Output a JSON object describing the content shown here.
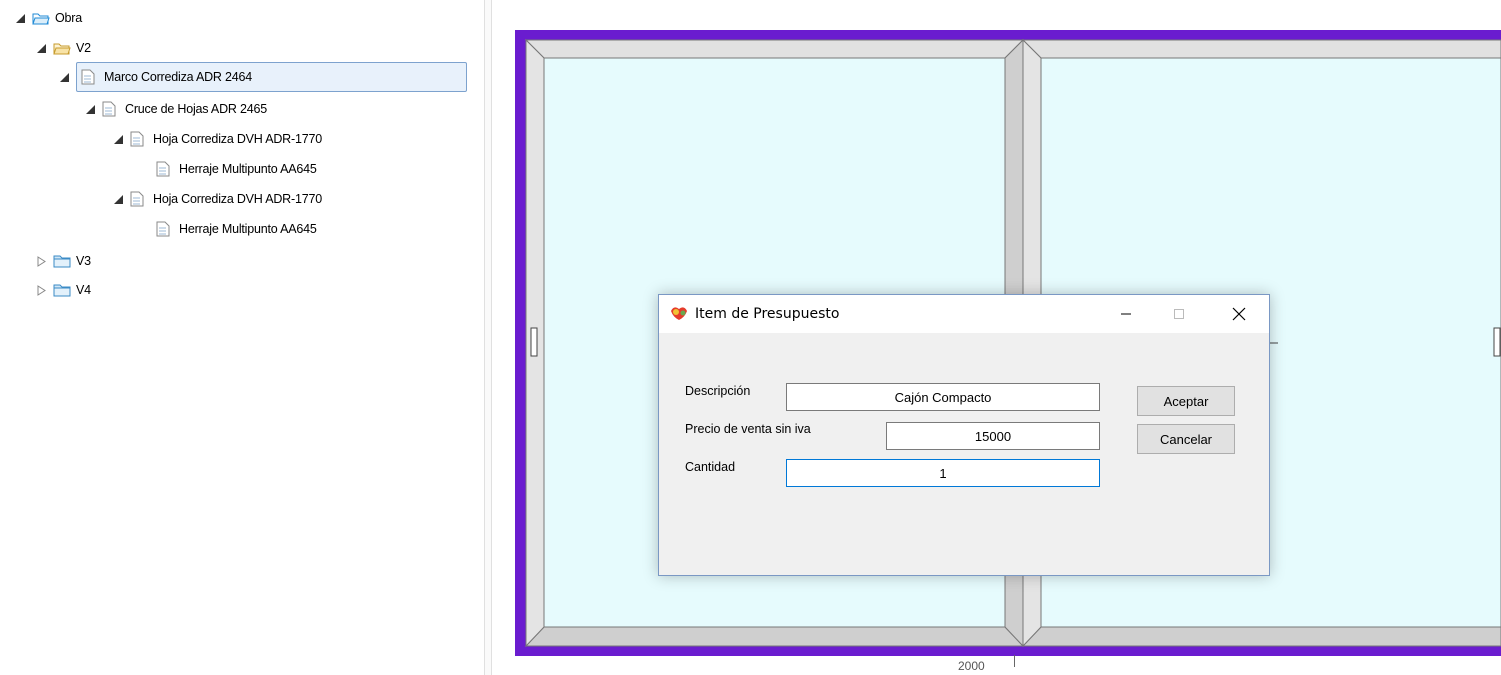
{
  "tree": {
    "obra": "Obra",
    "v2": "V2",
    "marco": "Marco Corrediza ADR 2464",
    "cruce": "Cruce de Hojas ADR 2465",
    "hoja1": "Hoja Corrediza DVH ADR-1770",
    "herraje1": "Herraje Multipunto AA645",
    "hoja2": "Hoja Corrediza DVH ADR-1770",
    "herraje2": "Herraje Multipunto AA645",
    "v3": "V3",
    "v4": "V4"
  },
  "drawing": {
    "dimension": "2000",
    "frame_color": "#6a1ccf",
    "glass_color": "#e6fbfd",
    "profile_color": "#d9d9d9"
  },
  "dialog": {
    "title": "Item de Presupuesto",
    "descripcion_label": "Descripción",
    "descripcion_value": "Cajón Compacto",
    "precio_label": "Precio de venta sin iva",
    "precio_value": "15000",
    "cantidad_label": "Cantidad",
    "cantidad_value": "1",
    "aceptar": "Aceptar",
    "cancelar": "Cancelar"
  }
}
